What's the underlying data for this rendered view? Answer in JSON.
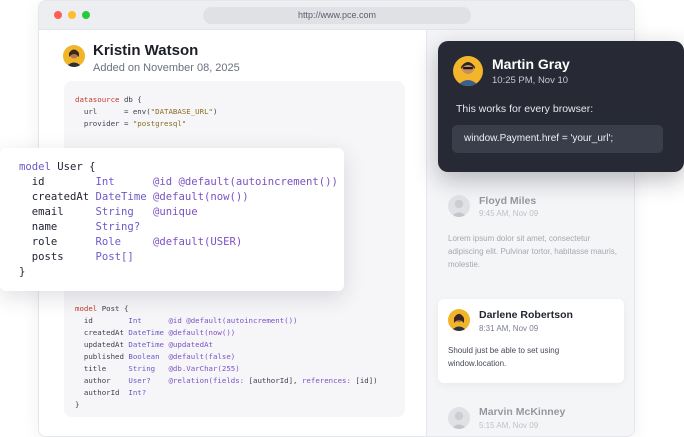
{
  "browser": {
    "url": "http://www.pce.com"
  },
  "post": {
    "author": "Kristin Watson",
    "date": "Added on November 08, 2025"
  },
  "code_block": {
    "datasource": [
      "datasource db {",
      "  url      = env(\"DATABASE_URL\")",
      "  provider = \"postgresql\""
    ],
    "post_model": [
      "model Post {",
      "  id        Int      @id @default(autoincrement())",
      "  createdAt DateTime @default(now())",
      "  updatedAt DateTime @updatedAt",
      "  published Boolean  @default(false)",
      "  title     String   @db.VarChar(255)",
      "  author    User?    @relation(fields: [authorId], references: [id])",
      "  authorId  Int?",
      "}"
    ]
  },
  "model_card": {
    "lines": [
      "model User {",
      "  id        Int      @id @default(autoincrement())",
      "  createdAt DateTime @default(now())",
      "  email     String   @unique",
      "  name      String?",
      "  role      Role     @default(USER)",
      "  posts     Post[]",
      "}"
    ]
  },
  "featured_comment": {
    "name": "Martin Gray",
    "time": "10:25 PM, Nov 10",
    "text": "This works for every browser:",
    "code": "window.Payment.href = 'your_url';"
  },
  "comments": [
    {
      "name": "Floyd Miles",
      "time": "9:45 AM, Nov 09",
      "body": "Lorem ipsum dolor sit amet, consectetur adipiscing elit. Pulvinar tortor, habitasse mauris, molestie.",
      "avatar_color": "#c9cbd1"
    },
    {
      "name": "Darlene Robertson",
      "time": "8:31 AM, Nov 09",
      "body_line1": "Should just be able to set using",
      "body_line2": "window.location.",
      "avatar_color": "#f2b52a"
    },
    {
      "name": "Marvin McKinney",
      "time": "5:15 AM, Nov 09",
      "avatar_color": "#c9cbd1"
    }
  ],
  "colors": {
    "accent_yellow": "#f2b52a",
    "dark_card": "#272934",
    "keyword": "#c0392b",
    "type": "#6f58c9"
  }
}
